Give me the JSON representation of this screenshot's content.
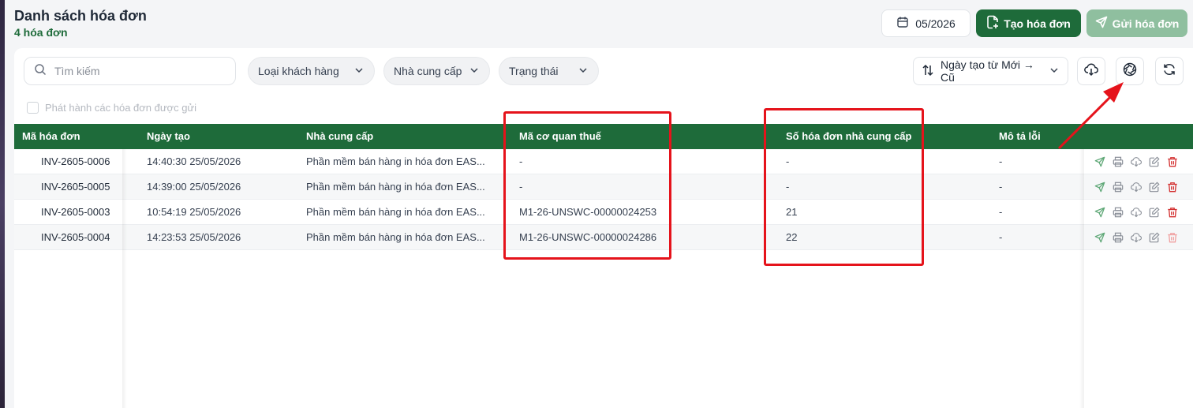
{
  "header": {
    "title": "Danh sách hóa đơn",
    "count": "4 hóa đơn",
    "month": "05/2026",
    "create_label": "Tạo hóa đơn",
    "send_label": "Gửi hóa đơn"
  },
  "toolbar": {
    "search_placeholder": "Tìm kiếm",
    "filters": [
      "Loại khách hàng",
      "Nhà cung cấp",
      "Trạng thái"
    ],
    "sort_label": "Ngày tạo từ Mới → Cũ",
    "publish_label": "Phát hành các hóa đơn được gửi"
  },
  "table": {
    "columns": [
      "Mã hóa đơn",
      "Ngày tạo",
      "Nhà cung cấp",
      "Mã cơ quan thuế",
      "Số hóa đơn nhà cung cấp",
      "Mô tả lỗi"
    ],
    "rows": [
      [
        "INV-2605-0006",
        "14:40:30 25/05/2026",
        "Phần mềm bán hàng in hóa đơn EAS...",
        "-",
        "-",
        "-"
      ],
      [
        "INV-2605-0005",
        "14:39:00 25/05/2026",
        "Phần mềm bán hàng in hóa đơn EAS...",
        "-",
        "-",
        "-"
      ],
      [
        "INV-2605-0003",
        "10:54:19 25/05/2026",
        "Phần mềm bán hàng in hóa đơn EAS...",
        "M1-26-UNSWC-00000024253",
        "21",
        "-"
      ],
      [
        "INV-2605-0004",
        "14:23:53 25/05/2026",
        "Phần mềm bán hàng in hóa đơn EAS...",
        "M1-26-UNSWC-00000024286",
        "22",
        "-"
      ]
    ],
    "delete_enabled": [
      true,
      true,
      true,
      false
    ]
  },
  "colors": {
    "primary": "#1e6b3a",
    "primary_disabled": "#8fbf9f",
    "annotation": "#e5131b",
    "delete": "#d32f2f"
  },
  "icons": [
    "search-icon",
    "chevron-down-icon",
    "calendar-icon",
    "file-plus-icon",
    "send-icon",
    "sort-icon",
    "cloud-download-icon",
    "aperture-icon",
    "refresh-icon",
    "print-icon",
    "edit-icon",
    "trash-icon"
  ]
}
